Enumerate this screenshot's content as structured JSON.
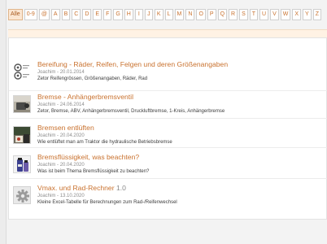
{
  "alphabet_filter": [
    "Alle",
    "0-9",
    "@",
    "A",
    "B",
    "C",
    "D",
    "E",
    "F",
    "G",
    "H",
    "I",
    "J",
    "K",
    "L",
    "M",
    "N",
    "O",
    "P",
    "Q",
    "R",
    "S",
    "T",
    "U",
    "V",
    "W",
    "X",
    "Y",
    "Z"
  ],
  "active_filter": "Alle",
  "entries": [
    {
      "title": "Bereifung - Räder, Reifen, Felgen und deren Größenangaben",
      "author": "Joachim",
      "date": "20.01.2014",
      "description": "Zetor Reifengrössen, Größenangaben, Räder, Rad",
      "thumbnail": "wheel-tires-icon"
    },
    {
      "title": "Bremse - Anhängerbremsventil",
      "author": "Joachim",
      "date": "24.06.2014",
      "description": "Zetor, Bremse, ABV, Anhängerbremsventil, Druckluftbremse, 1-Kreis, Anhängerbremse",
      "thumbnail": "brake-valve-photo"
    },
    {
      "title": "Bremsen entlüften",
      "author": "Joachim",
      "date": "20.04.2020",
      "description": "Wie entlüftet man am Traktor die hydraulische Betriebsbremse",
      "thumbnail": "brake-bleeding-photo"
    },
    {
      "title": "Bremsflüssigkeit, was beachten?",
      "author": "Joachim",
      "date": "20.04.2020",
      "description": "Was ist beim Thema Bremsflüssigkeit zu beachten?",
      "thumbnail": "brake-fluid-bottle-photo"
    },
    {
      "title": "Vmax. und Rad-Rechner",
      "version": "1.0",
      "author": "Joachim",
      "date": "13.10.2020",
      "description": "Kleine Excel-Tabelle für Berechnungen zum Rad-/Reifenwechsel",
      "thumbnail": "gear-icon"
    }
  ]
}
